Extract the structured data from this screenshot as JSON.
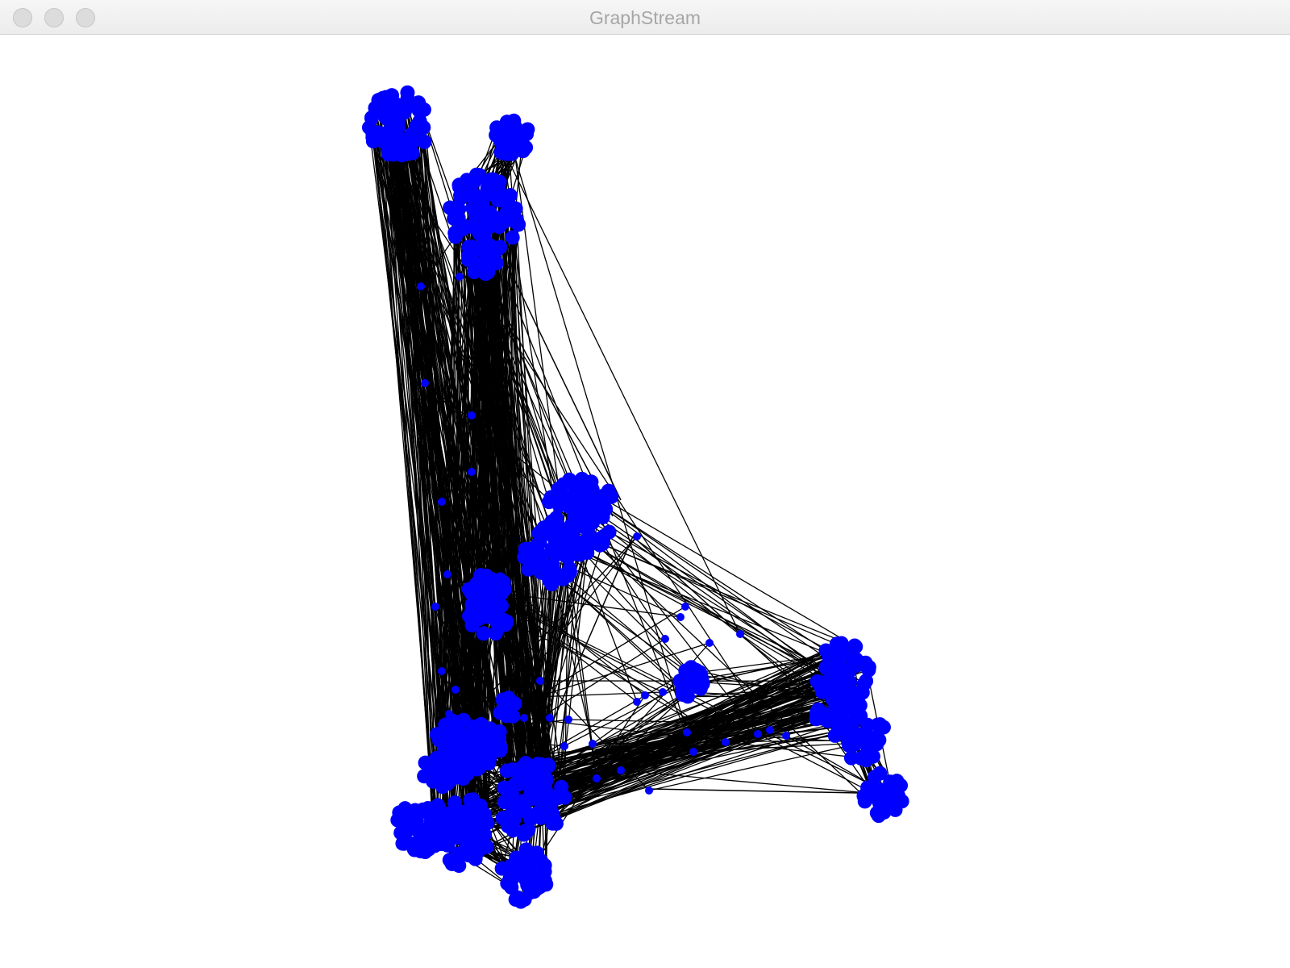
{
  "window": {
    "title": "GraphStream"
  },
  "graph": {
    "node_color": "#0000ff",
    "edge_color": "#000000",
    "background": "#ffffff"
  }
}
